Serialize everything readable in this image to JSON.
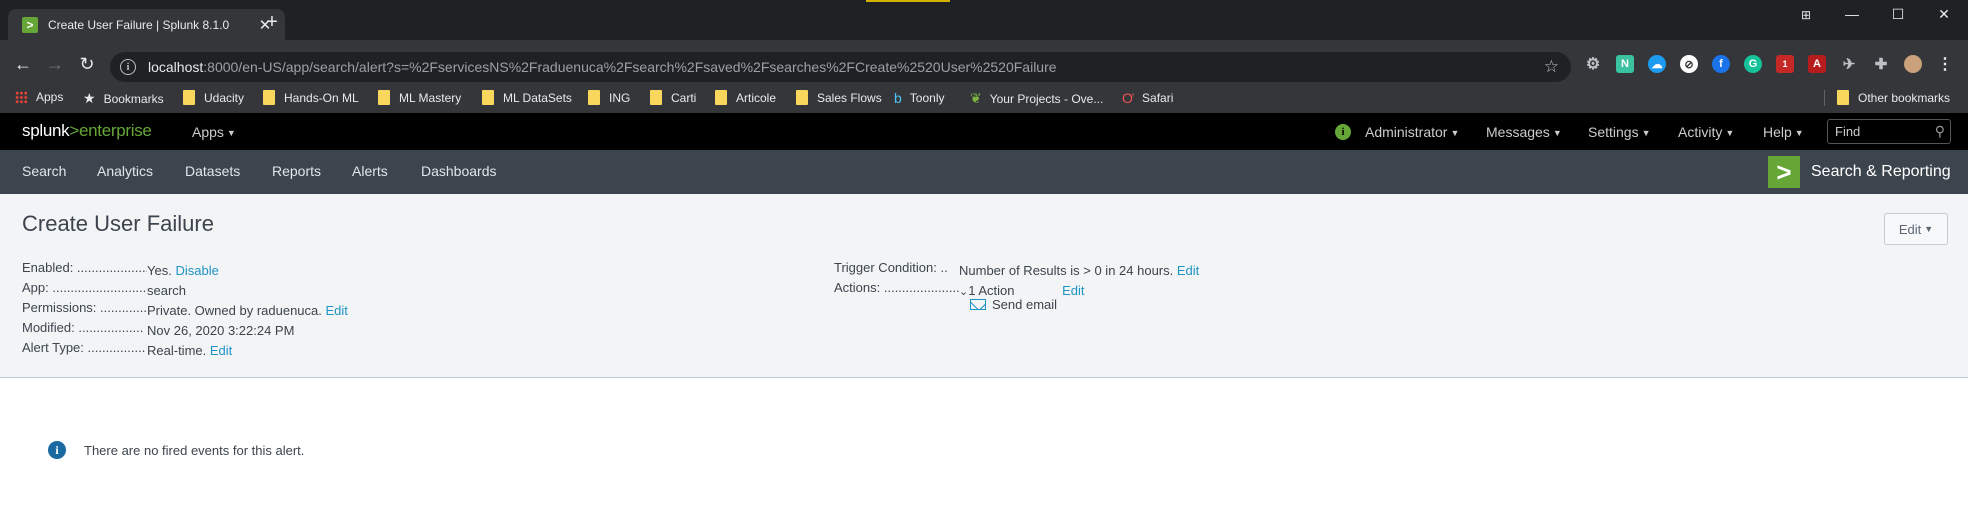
{
  "browser": {
    "tab_title": "Create User Failure | Splunk 8.1.0",
    "url_host": "localhost",
    "url_rest": ":8000/en-US/app/search/alert?s=%2FservicesNS%2Fraduenuca%2Fsearch%2Fsaved%2Fsearches%2FCreate%2520User%2520Failure",
    "bookmarks": [
      "Apps",
      "Bookmarks",
      "Udacity",
      "Hands-On ML",
      "ML Mastery",
      "ML DataSets",
      "ING",
      "Carti",
      "Articole",
      "Sales Flows",
      "Toonly",
      "Your Projects - Ove...",
      "Safari"
    ],
    "other_bookmarks": "Other bookmarks",
    "ext_badge": "1"
  },
  "splunk": {
    "logo_a": "splunk",
    "logo_b": ">",
    "logo_c": "enterprise",
    "apps_menu": "Apps",
    "header_menus": [
      "Administrator",
      "Messages",
      "Settings",
      "Activity",
      "Help"
    ],
    "find_placeholder": "Find",
    "app_nav": [
      "Search",
      "Analytics",
      "Datasets",
      "Reports",
      "Alerts",
      "Dashboards"
    ],
    "app_name": "Search & Reporting"
  },
  "alert": {
    "title": "Create User Failure",
    "edit_button": "Edit",
    "left": [
      {
        "key": "Enabled: ....................",
        "value": "Yes.",
        "link": "Disable"
      },
      {
        "key": "App: ...........................",
        "value": "search",
        "link": ""
      },
      {
        "key": "Permissions: .............",
        "value": "Private. Owned by raduenuca.",
        "link": "Edit"
      },
      {
        "key": "Modified: ..................",
        "value": "Nov 26, 2020 3:22:24 PM",
        "link": ""
      },
      {
        "key": "Alert Type: ................",
        "value": "Real-time.",
        "link": "Edit"
      }
    ],
    "trigger": {
      "key": "Trigger Condition: ..",
      "value": "Number of Results is > 0 in 24 hours.",
      "link": "Edit"
    },
    "actions": {
      "key": "Actions: .....................",
      "value": "1 Action",
      "link": "Edit"
    },
    "action_item": "Send email",
    "no_events": "There are no fired events for this alert."
  },
  "colors": {
    "splunk_green": "#65a637",
    "link_blue": "#1e93c6",
    "appbar": "#3c444d"
  }
}
